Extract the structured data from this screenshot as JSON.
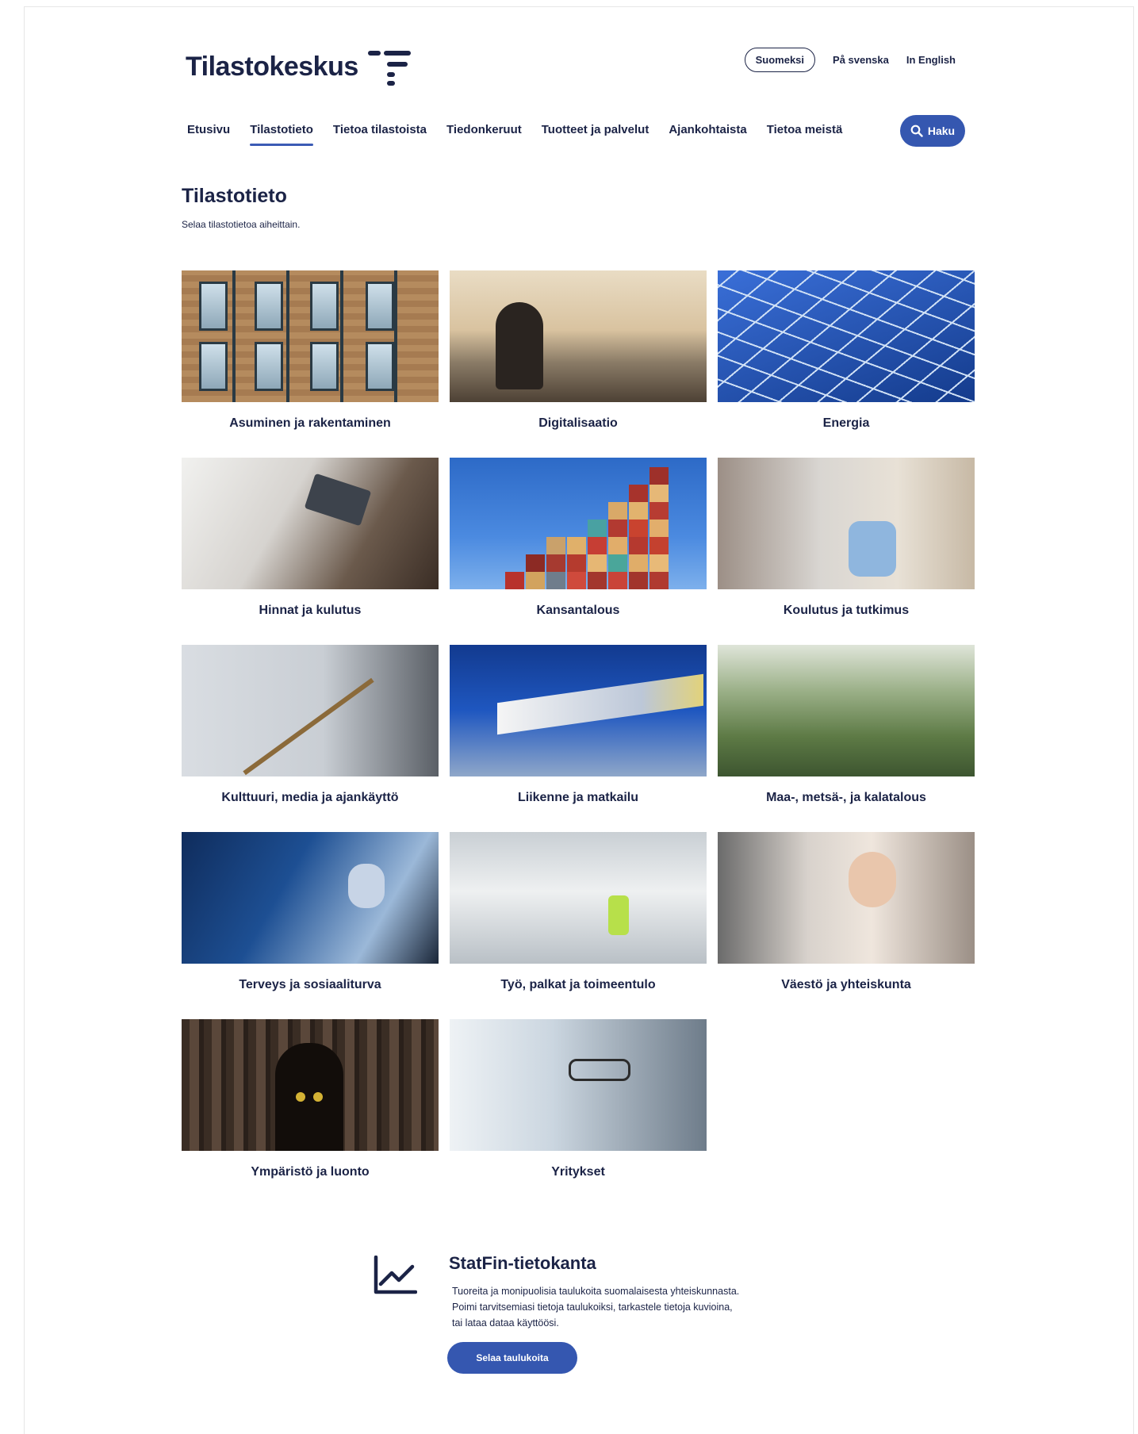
{
  "header": {
    "logo_text": "Tilastokeskus",
    "languages": [
      "Suomeksi",
      "På svenska",
      "In English"
    ],
    "active_language": "Suomeksi"
  },
  "nav": {
    "items": [
      "Etusivu",
      "Tilastotieto",
      "Tietoa tilastoista",
      "Tiedonkeruut",
      "Tuotteet ja palvelut",
      "Ajankohtaista",
      "Tietoa meistä"
    ],
    "active": "Tilastotieto",
    "search_label": "Haku"
  },
  "page": {
    "title": "Tilastotieto",
    "subtitle": "Selaa tilastotietoa aiheittain."
  },
  "topics": [
    {
      "label": "Asuminen ja rakentaminen",
      "image": "building-facade"
    },
    {
      "label": "Digitalisaatio",
      "image": "person-laptop-mountain"
    },
    {
      "label": "Energia",
      "image": "solar-panels"
    },
    {
      "label": "Hinnat ja kulutus",
      "image": "credit-card-payment"
    },
    {
      "label": "Kansantalous",
      "image": "shipping-containers"
    },
    {
      "label": "Koulutus ja tutkimus",
      "image": "child-walking-backpack"
    },
    {
      "label": "Kulttuuri, media ja ajankäyttö",
      "image": "trombone-player"
    },
    {
      "label": "Liikenne ja matkailu",
      "image": "moving-train"
    },
    {
      "label": "Maa-, metsä-, ja kalatalous",
      "image": "wheat-field"
    },
    {
      "label": "Terveys ja sosiaaliturva",
      "image": "surgeon"
    },
    {
      "label": "Työ, palkat ja toimeentulo",
      "image": "worker-wind-turbine"
    },
    {
      "label": "Väestö ja yhteiskunta",
      "image": "girl-with-baby"
    },
    {
      "label": "Ympäristö ja luonto",
      "image": "owl-in-tree"
    },
    {
      "label": "Yritykset",
      "image": "lab-worker-goggles"
    }
  ],
  "statfin": {
    "title": "StatFin-tietokanta",
    "description_lines": [
      "Tuoreita ja monipuolisia taulukoita suomalaisesta yhteiskunnasta.",
      "Poimi tarvitsemiasi tietoja taulukoiksi, tarkastele tietoja kuvioina,",
      "tai lataa dataa käyttöösi."
    ],
    "button_label": "Selaa taulukoita",
    "icon": "line-chart-icon"
  },
  "colors": {
    "text": "#1b2346",
    "accent": "#3557b0"
  }
}
